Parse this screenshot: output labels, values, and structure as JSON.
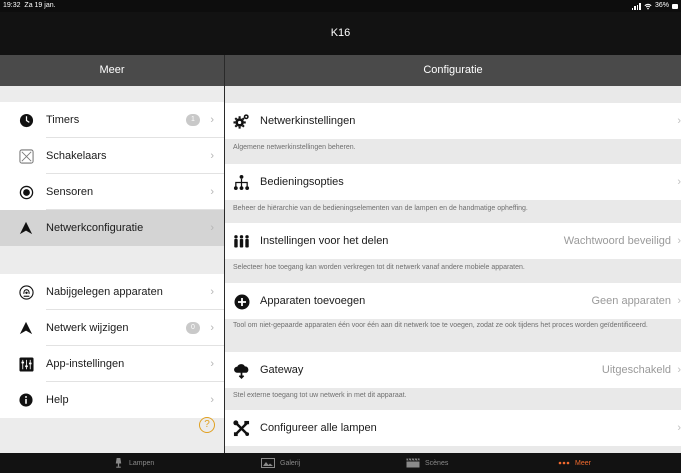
{
  "status": {
    "time": "19:32",
    "date": "Za 19 jan.",
    "battery": "36%"
  },
  "app": {
    "title": "K16"
  },
  "left": {
    "header": "Meer",
    "group1": [
      {
        "label": "Timers",
        "icon": "clock-icon",
        "badge": "1"
      },
      {
        "label": "Schakelaars",
        "icon": "switch-icon"
      },
      {
        "label": "Sensoren",
        "icon": "sensor-icon"
      },
      {
        "label": "Netwerkconfiguratie",
        "icon": "network-config-icon",
        "selected": true
      }
    ],
    "group2": [
      {
        "label": "Nabijgelegen apparaten",
        "icon": "nearby-devices-icon"
      },
      {
        "label": "Netwerk wijzigen",
        "icon": "network-change-icon",
        "badge": "0"
      },
      {
        "label": "App-instellingen",
        "icon": "app-settings-icon"
      },
      {
        "label": "Help",
        "icon": "info-icon"
      }
    ],
    "help_symbol": "?"
  },
  "right": {
    "header": "Configuratie",
    "rows": [
      {
        "label": "Netwerkinstellingen",
        "value": "",
        "icon": "gear-icon",
        "desc": "Algemene netwerkinstellingen beheren."
      },
      {
        "label": "Bedieningsopties",
        "value": "",
        "icon": "hierarchy-icon",
        "desc": "Beheer de hiërarchie van de bedieningselementen van de lampen en de handmatige opheffing."
      },
      {
        "label": "Instellingen voor het delen",
        "value": "Wachtwoord beveiligd",
        "icon": "people-icon",
        "desc": "Selecteer hoe toegang kan worden verkregen tot dit netwerk vanaf andere mobiele apparaten."
      },
      {
        "label": "Apparaten toevoegen",
        "value": "Geen apparaten",
        "icon": "add-icon",
        "desc": "Tool om niet-gepaarde apparaten één voor één aan dit netwerk toe te voegen, zodat ze ook tijdens het proces worden geïdentificeerd."
      },
      {
        "label": "Gateway",
        "value": "Uitgeschakeld",
        "icon": "cloud-icon",
        "desc": "Stel externe toegang tot uw netwerk in met dit apparaat."
      },
      {
        "label": "Configureer alle lampen",
        "value": "",
        "icon": "tools-icon",
        "desc": ""
      }
    ]
  },
  "tabs": [
    {
      "label": "Lampen",
      "icon": "lamp-icon"
    },
    {
      "label": "Galerij",
      "icon": "gallery-icon"
    },
    {
      "label": "Scènes",
      "icon": "scenes-icon"
    },
    {
      "label": "Meer",
      "icon": "more-icon",
      "active": true
    }
  ],
  "colors": {
    "accent": "#f26a2e",
    "header": "#4a4a4a",
    "bar": "#121212"
  }
}
